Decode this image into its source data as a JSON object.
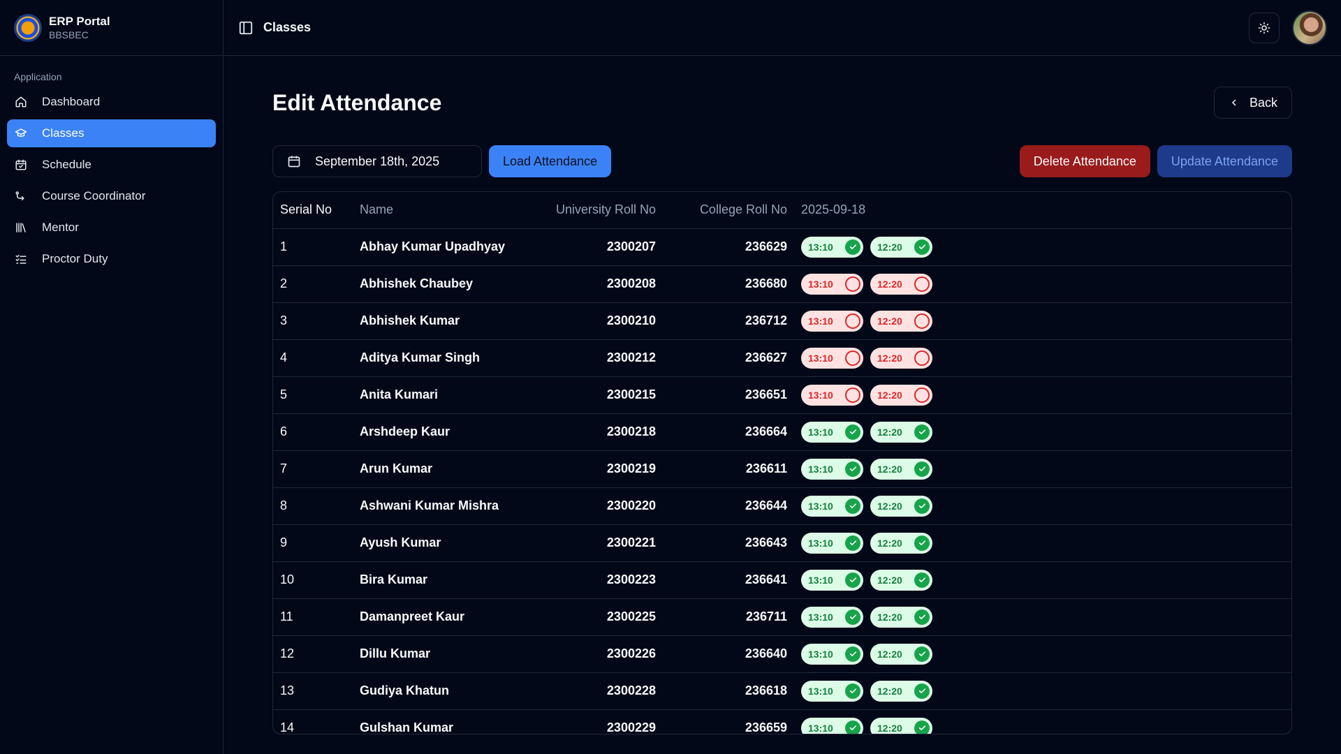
{
  "brand": {
    "title": "ERP Portal",
    "subtitle": "BBSBEC"
  },
  "sidebar": {
    "group_label": "Application",
    "items": [
      {
        "label": "Dashboard",
        "icon": "home-icon",
        "active": false
      },
      {
        "label": "Classes",
        "icon": "graduation-cap-icon",
        "active": true
      },
      {
        "label": "Schedule",
        "icon": "calendar-check-icon",
        "active": false
      },
      {
        "label": "Course Coordinator",
        "icon": "route-icon",
        "active": false
      },
      {
        "label": "Mentor",
        "icon": "library-icon",
        "active": false
      },
      {
        "label": "Proctor Duty",
        "icon": "list-checks-icon",
        "active": false
      }
    ]
  },
  "topbar": {
    "breadcrumb": "Classes",
    "panel_icon": "panel-left-icon",
    "theme_icon": "sun-icon"
  },
  "page": {
    "title": "Edit Attendance",
    "back_label": "Back",
    "date_value": "September 18th, 2025",
    "load_label": "Load Attendance",
    "delete_label": "Delete Attendance",
    "update_label": "Update Attendance"
  },
  "colors": {
    "accent": "#3b82f6",
    "danger": "#991b1b",
    "present_bg": "#dcfce7",
    "present_fg": "#15803d",
    "absent_bg": "#fee2e2",
    "absent_fg": "#dc2626"
  },
  "table": {
    "headers": {
      "serial": "Serial No",
      "name": "Name",
      "uroll": "University Roll No",
      "croll": "College Roll No",
      "date": "2025-09-18"
    },
    "slots": [
      "13:10",
      "12:20"
    ],
    "rows": [
      {
        "serial": "1",
        "name": "Abhay Kumar Upadhyay",
        "uroll": "2300207",
        "croll": "236629",
        "status": [
          "present",
          "present"
        ]
      },
      {
        "serial": "2",
        "name": "Abhishek Chaubey",
        "uroll": "2300208",
        "croll": "236680",
        "status": [
          "absent",
          "absent"
        ]
      },
      {
        "serial": "3",
        "name": "Abhishek Kumar",
        "uroll": "2300210",
        "croll": "236712",
        "status": [
          "absent",
          "absent"
        ]
      },
      {
        "serial": "4",
        "name": "Aditya Kumar Singh",
        "uroll": "2300212",
        "croll": "236627",
        "status": [
          "absent",
          "absent"
        ]
      },
      {
        "serial": "5",
        "name": "Anita Kumari",
        "uroll": "2300215",
        "croll": "236651",
        "status": [
          "absent",
          "absent"
        ]
      },
      {
        "serial": "6",
        "name": "Arshdeep Kaur",
        "uroll": "2300218",
        "croll": "236664",
        "status": [
          "present",
          "present"
        ]
      },
      {
        "serial": "7",
        "name": "Arun Kumar",
        "uroll": "2300219",
        "croll": "236611",
        "status": [
          "present",
          "present"
        ]
      },
      {
        "serial": "8",
        "name": "Ashwani Kumar Mishra",
        "uroll": "2300220",
        "croll": "236644",
        "status": [
          "present",
          "present"
        ]
      },
      {
        "serial": "9",
        "name": "Ayush Kumar",
        "uroll": "2300221",
        "croll": "236643",
        "status": [
          "present",
          "present"
        ]
      },
      {
        "serial": "10",
        "name": "Bira Kumar",
        "uroll": "2300223",
        "croll": "236641",
        "status": [
          "present",
          "present"
        ]
      },
      {
        "serial": "11",
        "name": "Damanpreet Kaur",
        "uroll": "2300225",
        "croll": "236711",
        "status": [
          "present",
          "present"
        ]
      },
      {
        "serial": "12",
        "name": "Dillu Kumar",
        "uroll": "2300226",
        "croll": "236640",
        "status": [
          "present",
          "present"
        ]
      },
      {
        "serial": "13",
        "name": "Gudiya Khatun",
        "uroll": "2300228",
        "croll": "236618",
        "status": [
          "present",
          "present"
        ]
      },
      {
        "serial": "14",
        "name": "Gulshan Kumar",
        "uroll": "2300229",
        "croll": "236659",
        "status": [
          "present",
          "present"
        ]
      }
    ]
  }
}
